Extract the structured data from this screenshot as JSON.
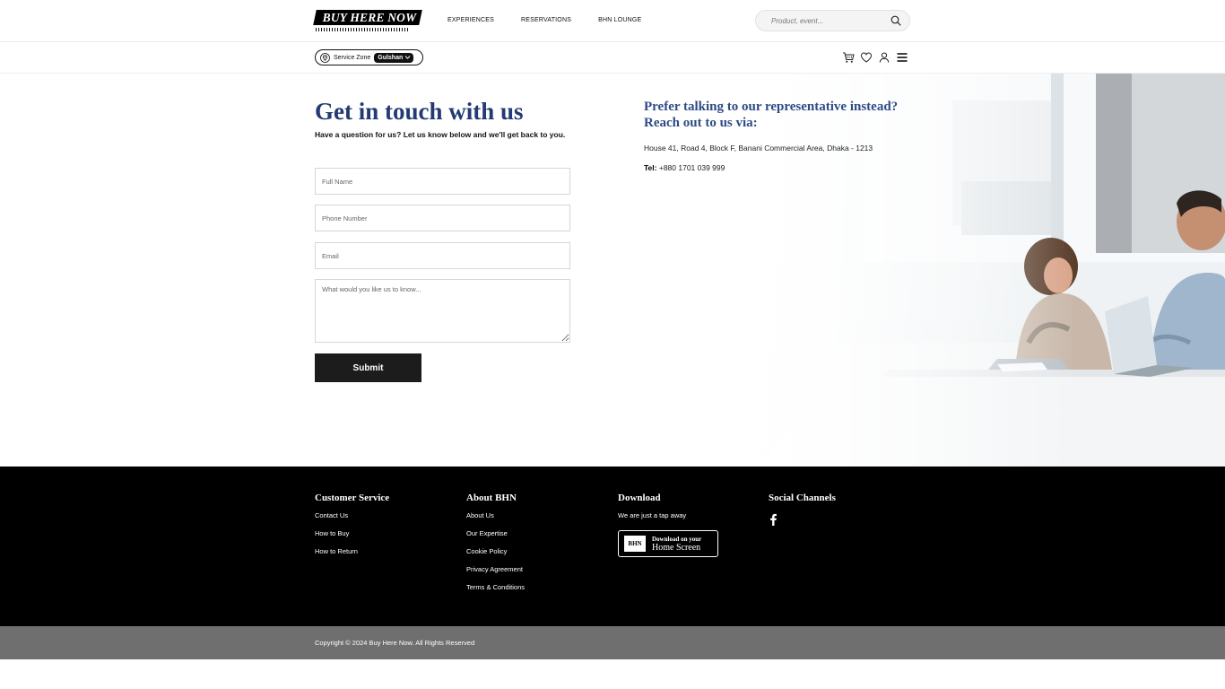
{
  "header": {
    "logo_text": "BUY HERE NOW",
    "nav": [
      "EXPERIENCES",
      "RESERVATIONS",
      "BHN LOUNGE"
    ],
    "search_placeholder": "Product, event..."
  },
  "subheader": {
    "zone_label": "Service Zone",
    "zone_value": "Gulshan",
    "icons": [
      "cart-icon",
      "heart-icon",
      "user-icon",
      "menu-icon"
    ]
  },
  "contact": {
    "title": "Get in touch with us",
    "subtitle": "Have a question for us? Let us know below and we'll get back to you.",
    "fields": {
      "name_placeholder": "Full Name",
      "phone_placeholder": "Phone Number",
      "email_placeholder": "Email",
      "message_placeholder": "What would you like us to know..."
    },
    "submit_label": "Submit"
  },
  "representative": {
    "title": "Prefer talking to our representative instead? Reach out to us via:",
    "address": "House 41, Road 4, Block F, Banani Commercial Area, Dhaka - 1213",
    "tel_label": "Tel:",
    "tel_value": "+880 1701 039 999"
  },
  "footer": {
    "customer_service": {
      "heading": "Customer Service",
      "links": [
        "Contact Us",
        "How to Buy",
        "How to Return"
      ]
    },
    "about": {
      "heading": "About BHN",
      "links": [
        "About Us",
        "Our Expertise",
        "Cookie Policy",
        "Privacy Agreement",
        "Terms & Conditions"
      ]
    },
    "download": {
      "heading": "Download",
      "text": "We are just a tap away",
      "badge": "BHN",
      "btn_small": "Download on your",
      "btn_large": "Home Screen"
    },
    "social": {
      "heading": "Social Channels",
      "icons": [
        "facebook-icon"
      ]
    },
    "copyright": "Copyright © 2024 Buy Here Now. All Rights Reserved"
  },
  "colors": {
    "title_blue": "#233a72",
    "rep_blue": "#2e4a86",
    "footer_bg": "#000000",
    "copyright_bg": "#6f6f6f",
    "button_bg": "#1c1c1c"
  }
}
